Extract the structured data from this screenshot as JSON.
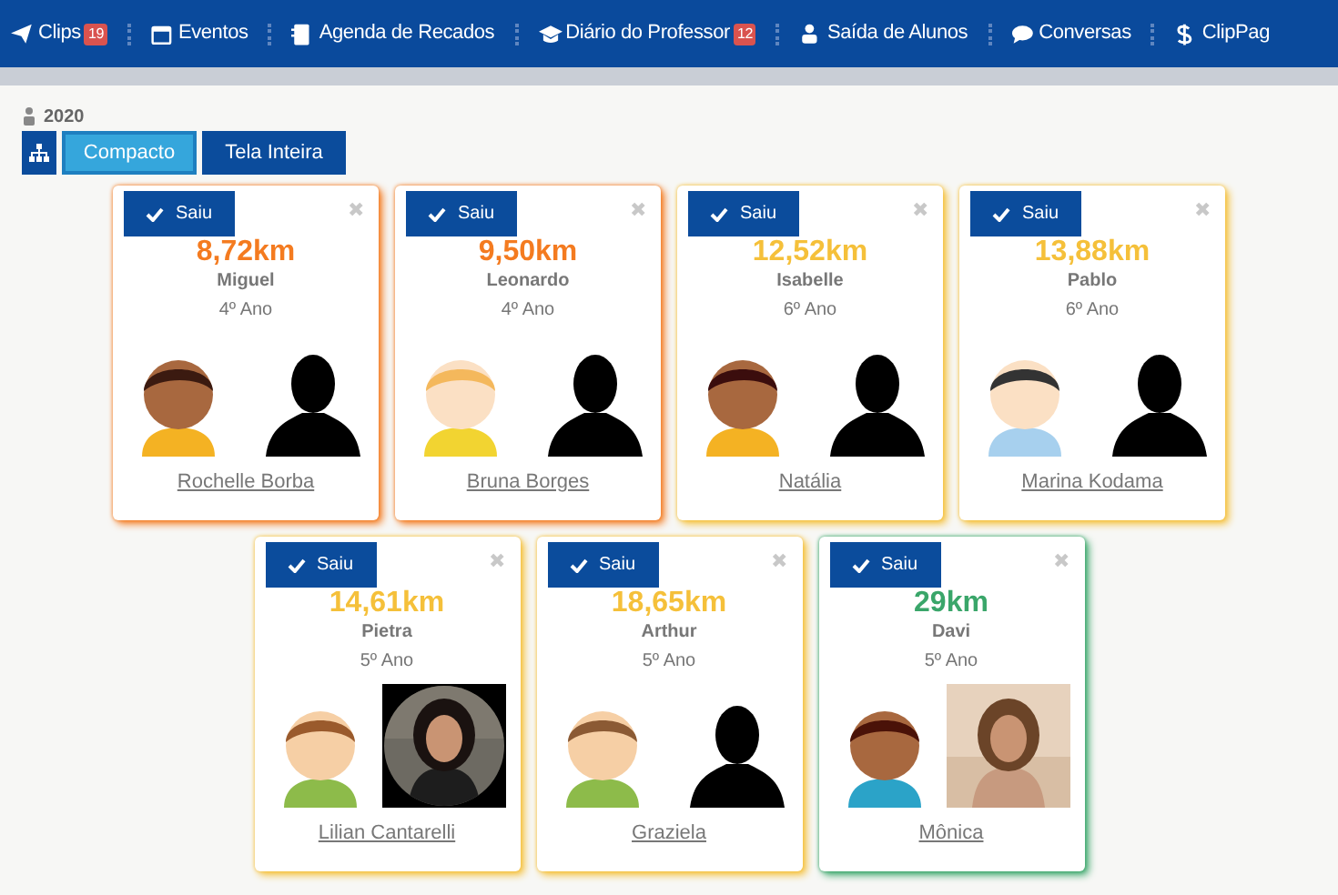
{
  "nav": [
    {
      "label": "Clips",
      "kind": "plane",
      "badge": "19"
    },
    {
      "label": "Eventos",
      "kind": "calendar"
    },
    {
      "label": "Agenda de Recados",
      "kind": "book"
    },
    {
      "label": "Diário do Professor",
      "kind": "cap",
      "badge": "12"
    },
    {
      "label": "Saída de Alunos",
      "kind": "person"
    },
    {
      "label": "Conversas",
      "kind": "chat"
    },
    {
      "label": "ClipPag",
      "kind": "dollar"
    }
  ],
  "year": "2020",
  "view_tabs": [
    {
      "label": "Compacto",
      "selected": true
    },
    {
      "label": "Tela Inteira",
      "selected": false
    }
  ],
  "cards": [
    {
      "button": "Saiu",
      "close": "✖",
      "distance": "8,72km",
      "color": "#f47b20",
      "student": "Miguel",
      "grade": "4º Ano",
      "guardian": {
        "name": "Rochelle Borba",
        "kind": "silhouette"
      }
    },
    {
      "button": "Saiu",
      "close": "✖",
      "distance": "9,50km",
      "color": "#f47b20",
      "student": "Leonardo",
      "grade": "4º Ano",
      "guardian": {
        "name": "Bruna Borges",
        "kind": "silhouette"
      }
    },
    {
      "button": "Saiu",
      "close": "✖",
      "distance": "12,52km",
      "color": "#f5c03a",
      "student": "Isabelle",
      "grade": "6º Ano",
      "guardian": {
        "name": "Natália",
        "kind": "silhouette"
      }
    },
    {
      "button": "Saiu",
      "close": "✖",
      "distance": "13,88km",
      "color": "#f5c03a",
      "student": "Pablo",
      "grade": "6º Ano",
      "guardian": {
        "name": "Marina Kodama",
        "kind": "silhouette"
      }
    },
    {
      "button": "Saiu",
      "close": "✖",
      "distance": "14,61km",
      "color": "#f5c03a",
      "student": "Pietra",
      "grade": "5º Ano",
      "guardian": {
        "name": "Lilian Cantarelli",
        "kind": "round_photo"
      }
    },
    {
      "button": "Saiu",
      "close": "✖",
      "distance": "18,65km",
      "color": "#f5c03a",
      "student": "Arthur",
      "grade": "5º Ano",
      "guardian": {
        "name": "Graziela",
        "kind": "silhouette"
      }
    },
    {
      "button": "Saiu",
      "close": "✖",
      "distance": "29km",
      "color": "#3aa66a",
      "student": "Davi",
      "grade": "5º Ano",
      "guardian": {
        "name": "Mônica"
      }
    }
  ]
}
